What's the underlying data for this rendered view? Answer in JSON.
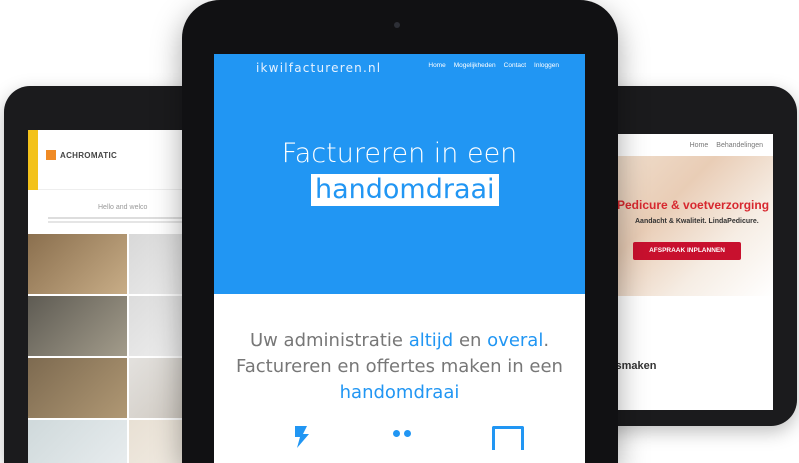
{
  "center_site": {
    "brand": "ikwilfactureren.nl",
    "nav": [
      {
        "label": "Home"
      },
      {
        "label": "Mogelijkheden"
      },
      {
        "label": "Contact"
      },
      {
        "label": "Inloggen"
      }
    ],
    "hero_line1": "Factureren in een",
    "hero_line2": "handomdraai",
    "tagline": {
      "part1": "Uw administratie ",
      "accent1": "altijd",
      "part2": " en ",
      "accent2": "overal",
      "part3": ".",
      "line2": "Factureren en offertes maken in een",
      "line3": "handomdraai"
    },
    "feature_icons": [
      "bolt-icon",
      "dots-icon",
      "screen-icon"
    ]
  },
  "left_site": {
    "logo_text": "ACHROMATIC",
    "hello": "Hello and welco"
  },
  "right_site": {
    "nav": [
      {
        "label": "Home"
      },
      {
        "label": "Behandelingen"
      }
    ],
    "title": "Pedicure & voetverzorging",
    "subtitle": "Aandacht & Kwaliteit. LindaPedicure.",
    "cta": "AFSPRAAK INPLANNEN",
    "heading": "nnismaken"
  },
  "colors": {
    "brand_blue": "#2196f3",
    "achromatic_yellow": "#f3c21b",
    "pedicure_red": "#c8102e",
    "device_frame": "#111113"
  }
}
